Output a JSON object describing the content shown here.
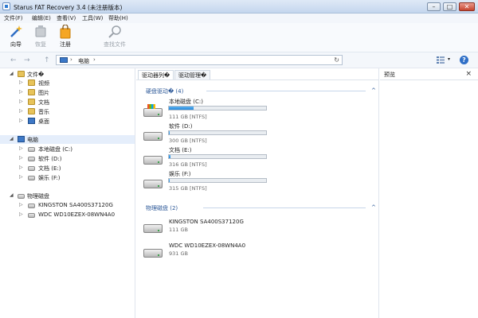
{
  "window": {
    "title": "Starus FAT Recovery 3.4 (未注册版本)",
    "min": "–",
    "max": "□",
    "close": "✕"
  },
  "menu": [
    {
      "label": "文件(F)"
    },
    {
      "label": "编辑(E)"
    },
    {
      "label": "查看(V)"
    },
    {
      "label": "工具(W)"
    },
    {
      "label": "帮助(H)"
    }
  ],
  "toolbar": {
    "wizard": "向导",
    "restore": "恢复",
    "register": "注册",
    "find": "查找文件"
  },
  "address": {
    "path": "电脑",
    "sep": "›",
    "refresh": "↻",
    "back": "←",
    "forward": "→",
    "up": "↑",
    "help": "?",
    "dropdown": "▾"
  },
  "tree": {
    "files_root": "文件�",
    "videos": "视频",
    "pictures": "图片",
    "documents": "文档",
    "music": "音乐",
    "desktop": "桌面",
    "computer": "电脑",
    "local_c": "本地磁盘 (C:)",
    "software_d": "软件 (D:)",
    "docs_e": "文档 (E:)",
    "ent_f": "娱乐 (F:)",
    "physical": "物理磁盘",
    "kingston": "KINGSTON SA400S37120G",
    "wdc": "WDC WD10EZEX-08WN4A0"
  },
  "tabs": {
    "driver_list": "驱动器列�",
    "driver_mgmt": "驱动管理�"
  },
  "sections": {
    "hard_drives": "硬盘驱动� (4)",
    "physical_disks": "物理磁盘 (2)",
    "chevron": "^"
  },
  "drives": [
    {
      "name": "本地磁盘 (C:)",
      "size": "111 GB [NTFS]",
      "used": 0.25
    },
    {
      "name": "软件 (D:)",
      "size": "300 GB [NTFS]",
      "used": 0.01
    },
    {
      "name": "文档 (E:)",
      "size": "316 GB [NTFS]",
      "used": 0.02
    },
    {
      "name": "娱乐 (F:)",
      "size": "315 GB [NTFS]",
      "used": 0.01
    }
  ],
  "disks": [
    {
      "name": "KINGSTON SA400S37120G",
      "size": "111 GB"
    },
    {
      "name": "WDC WD10EZEX-08WN4A0",
      "size": "931 GB"
    }
  ],
  "preview": {
    "title": "预览",
    "close": "×"
  }
}
